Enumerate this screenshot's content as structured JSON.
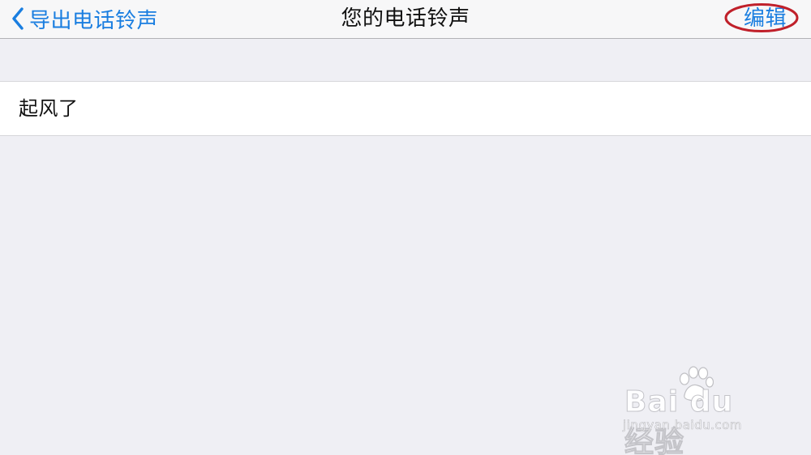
{
  "navbar": {
    "back_label": "导出电话铃声",
    "title": "您的电话铃声",
    "edit_label": "编辑"
  },
  "ringtones": {
    "items": [
      {
        "label": "起风了"
      }
    ]
  },
  "watermark": {
    "brand": "Bai  du 经验",
    "url": "jingyan.baidu.com"
  },
  "colors": {
    "accent": "#1a7ee0",
    "background": "#efeff4",
    "annotation": "#c0202a"
  },
  "icons": {
    "back": "chevron-left-icon",
    "watermark": "paw-icon"
  }
}
